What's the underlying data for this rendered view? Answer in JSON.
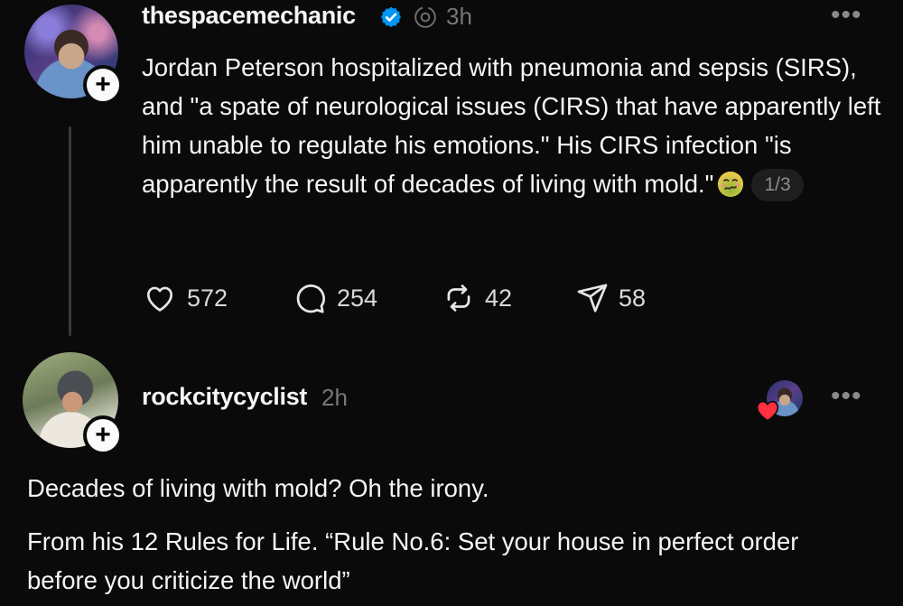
{
  "post": {
    "username": "thespacemechanic",
    "verified_icon": "verified-badge-icon",
    "time": "3h",
    "text": "Jordan Peterson hospitalized with pneumonia and sepsis (SIRS), and \"a spate of neurological issues (CIRS) that have apparently left him unable to regulate his emotions.\" His CIRS infection \"is apparently the result of decades of living with mold.\"",
    "emoji": "nauseated-face-emoji",
    "page_indicator": "1/3",
    "actions": {
      "likes": "572",
      "replies": "254",
      "reposts": "42",
      "shares": "58"
    },
    "more": "•••"
  },
  "reply": {
    "username": "rockcitycyclist",
    "time": "2h",
    "more": "•••",
    "paragraphs": [
      "Decades of living with mold? Oh the irony.",
      "From his 12 Rules for Life. “Rule No.6: Set your house in perfect order before you criticize the world”"
    ]
  },
  "colors": {
    "background": "#0a0a0a",
    "text": "#f3f5f7",
    "muted": "#777777",
    "verified": "#0095f6",
    "heart": "#ff3040"
  }
}
